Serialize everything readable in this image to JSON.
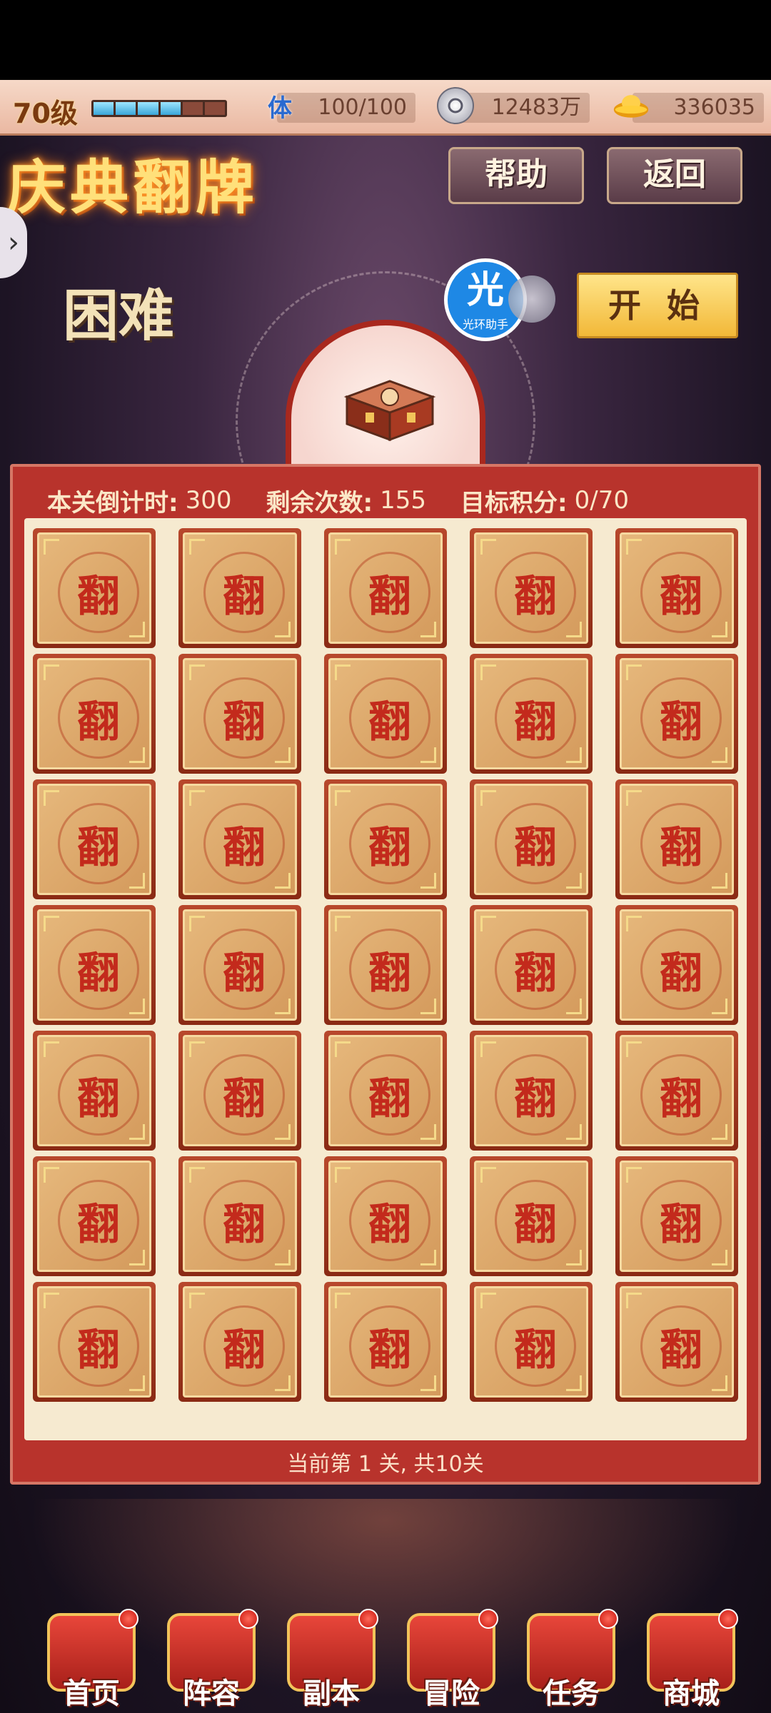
{
  "topbar": {
    "level": "70级",
    "xp_segments_filled": 4,
    "xp_segments_total": 6,
    "stamina_icon": "体",
    "stamina": "100/100",
    "silver": "12483万",
    "gold": "336035"
  },
  "header": {
    "title": "庆典翻牌",
    "help_label": "帮助",
    "back_label": "返回"
  },
  "stage": {
    "difficulty": "困难",
    "start_label": "开 始",
    "assist_big": "光",
    "assist_small": "光环助手"
  },
  "board": {
    "countdown_label": "本关倒计时:",
    "countdown_value": "300",
    "remaining_label": "剩余次数:",
    "remaining_value": "155",
    "target_label": "目标积分:",
    "target_value": "0/70",
    "card_glyph": "翻",
    "rows": 7,
    "cols": 5,
    "level_note": "当前第 1 关, 共10关"
  },
  "nav": {
    "items": [
      {
        "label": "首页",
        "icon": "home-icon"
      },
      {
        "label": "阵容",
        "icon": "lineup-icon"
      },
      {
        "label": "副本",
        "icon": "dungeon-icon"
      },
      {
        "label": "冒险",
        "icon": "adventure-icon"
      },
      {
        "label": "任务",
        "icon": "quest-icon"
      },
      {
        "label": "商城",
        "icon": "shop-icon"
      }
    ]
  },
  "colors": {
    "board_red": "#b8332c",
    "card_red_glyph": "#c32a1c",
    "title_gold": "#ffe07a",
    "start_gold": "#f2b838"
  }
}
